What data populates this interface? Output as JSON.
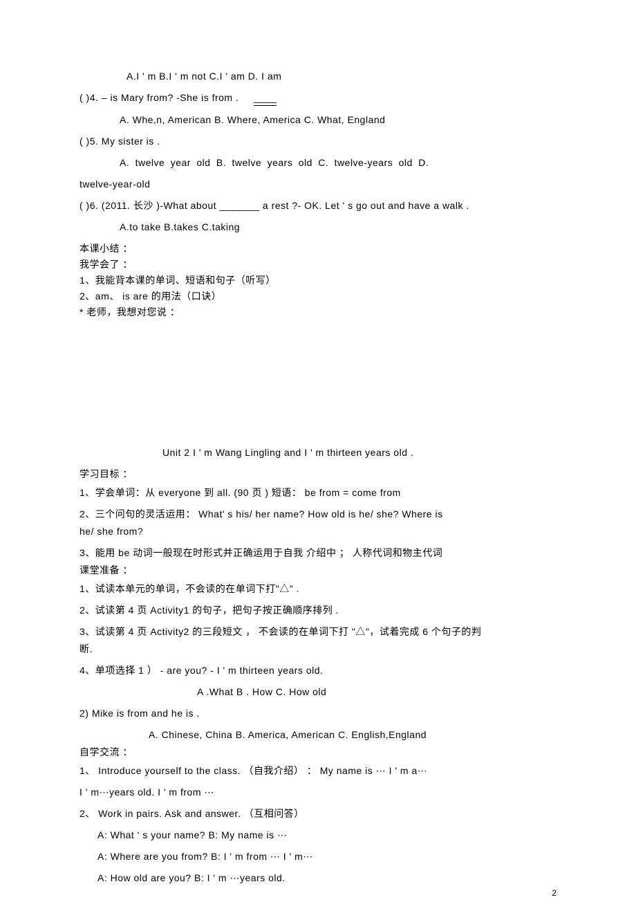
{
  "q3": {
    "choices": "A.I ' m   B.I   ' m not   C.I     ' am    D. I am"
  },
  "q4": {
    "stem": "(   )4.       – is Mary from? -She is from   .",
    "blank": "____",
    "choices": "A. Whe,n, American  B. Where, America C. What, England"
  },
  "q5": {
    "stem": "(   )5. My sister is .",
    "choicesA": "A.  twelve   year  old      B.  twelve  years  old    C.  twelve-years   old    D.",
    "choicesB": "twelve-year-old"
  },
  "q6": {
    "stem": "(  )6.    (2011. 长沙 )-What  about  _______  a rest  ?-  OK. Let  ' s go out  and have a walk  .",
    "choices": "A.to take  B.takes  C.taking"
  },
  "summary": {
    "title": "本课小结 ：",
    "l1": "我学会了 ：",
    "l2": "1、我能背本课的单词、短语和句子（听写）",
    "l3": "2、am、 is are   的用法（口诀）",
    "l4": "* 老师，我想对您说 ："
  },
  "unit2": {
    "title": "Unit 2 I    ' m Wang Lingling and I      ' m thirteen years old .",
    "goals_title": "学习目标 ：",
    "g1": "1、学会单词：从  everyone  到 all. (90    页 )    短语： be from = come from",
    "g2a": "2、三个问句的灵活运用：   What' s his/   her name?    How old is he/ she?   Where is",
    "g2b": "he/ she from?",
    "g3": "3、能用 be 动词一般现在时形式并正确运用于自我      介绍中 ； 人称代词和物主代词",
    "prep_title": "课堂准备 ：",
    "p1": "1、试读本单元的单词，不会读的在单词下打\"△\"      .",
    "p2": "2、试读第 4 页 Activity1   的句子，把句子按正确顺序排列   .",
    "p3a": "3、试读第 4 页 Activity2   的三段短文 ， 不会读的在单词下打  \"△\"，试着完成 6 个句子的判",
    "p3b": "断.",
    "p4": "4、单项选择  1 ） - are you?  -      I ' m thirteen years old.",
    "p4c": "A .What   B . How  C. How old",
    "p5": "2) Mike is from  and he is .",
    "p5c": "A. Chinese, China   B. America, American  C. English,England",
    "self_title": "自学交流 ：",
    "s1a": "1、 Introduce yourself to the class.         （自我介绍） ： My name is ⋯  I  ' m  a⋯",
    "s1b": "I ' m⋯years old.  I     ' m from ⋯",
    "s2": "2、 Work in pairs. Ask and answer.     （互相问答）",
    "s2a": "A: What ' s your name?      B: My name is       ⋯",
    "s2b": "A: Where are you from?     B: I          ' m from ⋯ I ' m⋯",
    "s2c": "A: How old are you?      B: I            ' m ⋯years old."
  },
  "pagenum": "2"
}
